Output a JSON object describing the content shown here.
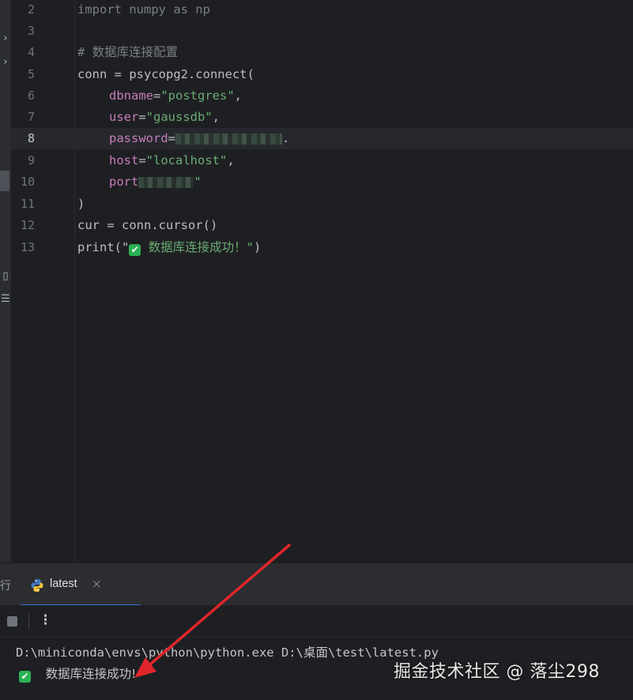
{
  "editor": {
    "current_line": "8",
    "lines": [
      {
        "num": "2",
        "text": "import numpy as np"
      },
      {
        "num": "3",
        "text": ""
      },
      {
        "num": "4",
        "text": "# 数据库连接配置"
      },
      {
        "num": "5",
        "text": "conn = psycopg2.connect("
      },
      {
        "num": "6",
        "parts": [
          "dbname",
          "=",
          "\"postgres\"",
          ","
        ]
      },
      {
        "num": "7",
        "parts": [
          "user",
          "=",
          "\"gaussdb\"",
          ","
        ]
      },
      {
        "num": "8",
        "parts": [
          "password",
          "=",
          "."
        ]
      },
      {
        "num": "9",
        "parts": [
          "host",
          "=",
          "\"localhost\"",
          ","
        ]
      },
      {
        "num": "10",
        "parts": [
          "port",
          "\""
        ]
      },
      {
        "num": "11",
        "text": ")"
      },
      {
        "num": "12",
        "text": "cur = conn.cursor()"
      },
      {
        "num": "13",
        "parts": [
          "print(\"",
          "✔",
          " 数据库连接成功！\"",
          ")"
        ]
      }
    ]
  },
  "run_panel": {
    "cut_tab_label": "行",
    "tab_label": "latest",
    "tab_close": "×",
    "more_icon": "⋮"
  },
  "console": {
    "command": "D:\\miniconda\\envs\\python\\python.exe D:\\桌面\\test\\latest.py",
    "check": "✔",
    "output": "数据库连接成功!"
  },
  "watermark": "掘金技术社区 @ 落尘298",
  "colors": {
    "keyword": "#cf8e6d",
    "string": "#6aab73",
    "param": "#c77dbb",
    "arrow": "#e0262a",
    "success": "#29b253"
  }
}
